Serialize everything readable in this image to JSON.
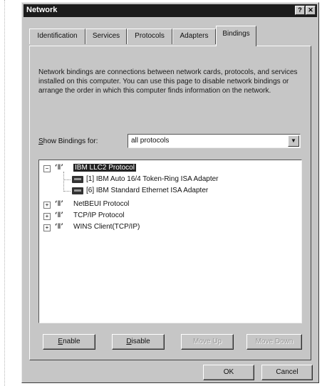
{
  "window": {
    "title": "Network",
    "help_glyph": "?",
    "close_glyph": "✕"
  },
  "tabs": [
    {
      "label": "Identification"
    },
    {
      "label": "Services"
    },
    {
      "label": "Protocols"
    },
    {
      "label": "Adapters"
    },
    {
      "label": "Bindings"
    }
  ],
  "active_tab": "Bindings",
  "description": "Network bindings are connections between network cards, protocols, and services installed on this computer. You can use this page to disable network bindings or arrange the order in which this computer finds information on the network.",
  "show_bindings": {
    "label_accel": "S",
    "label_rest": "how Bindings for:",
    "value": "all protocols",
    "arrow_glyph": "▼"
  },
  "tree": {
    "expanded_glyph": "−",
    "collapsed_glyph": "+",
    "protocol_icon_glyph": "‘ǁ’",
    "items": [
      {
        "label": "IBM LLC2 Protocol",
        "selected": true
      },
      {
        "label": "[1] IBM Auto 16/4 Token-Ring ISA Adapter"
      },
      {
        "label": "[6] IBM Standard Ethernet ISA Adapter"
      },
      {
        "label": "NetBEUI Protocol"
      },
      {
        "label": "TCP/IP Protocol"
      },
      {
        "label": "WINS Client(TCP/IP)"
      }
    ]
  },
  "buttons": {
    "enable_accel": "E",
    "enable_rest": "nable",
    "disable_accel": "D",
    "disable_rest": "isable",
    "move_up": "Move Up",
    "move_down": "Move Down",
    "ok": "OK",
    "cancel": "Cancel"
  }
}
